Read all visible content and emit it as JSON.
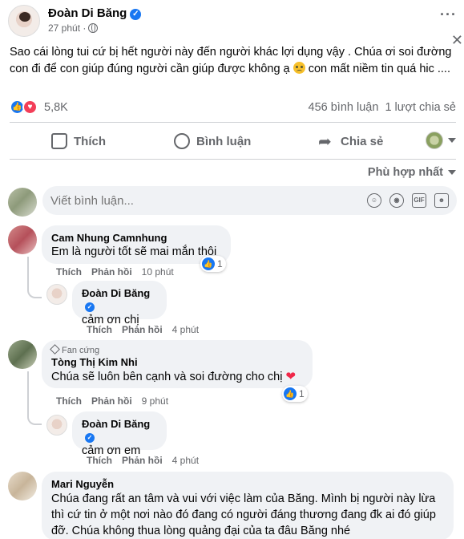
{
  "post": {
    "author": "Đoàn Di Băng",
    "time": "27 phút",
    "text": "Sao cái lòng tui cứ bị hết người này đến người khác lợi dụng vậy . Chúa ơi soi đường con đi để con giúp đúng người cần giúp được không ạ",
    "text_tail": "con mất niềm tin quá hic ....",
    "reaction_count": "5,8K",
    "comment_count": "456 bình luận",
    "share_count": "1 lượt chia sẻ"
  },
  "actions": {
    "like": "Thích",
    "comment": "Bình luận",
    "share": "Chia sẻ"
  },
  "sort_label": "Phù hợp nhất",
  "composer": {
    "placeholder": "Viết bình luận...",
    "gif_label": "GIF"
  },
  "comment_actions": {
    "like": "Thích",
    "reply": "Phản hồi"
  },
  "comments": [
    {
      "author": "Cam Nhung Camnhung",
      "body": "Em là người tốt sẽ mai mắn thôi",
      "time": "10 phút",
      "reactions": "1",
      "reply": {
        "author": "Đoàn Di Băng",
        "body": "cảm ơn chị",
        "time": "4 phút"
      }
    },
    {
      "badge": "Fan cứng",
      "author": "Tòng Thị Kim Nhi",
      "body": "Chúa sẽ luôn bên cạnh và soi đường cho chị",
      "time": "9 phút",
      "reactions": "1",
      "reply": {
        "author": "Đoàn Di Băng",
        "body": "cảm ơn em",
        "time": "4 phút"
      }
    },
    {
      "author": "Mari Nguyễn",
      "body": "Chúa đang rất an tâm và vui với việc làm của Băng. Mình bị người này lừa thì cứ tin ở một nơi nào đó đang có người đáng thương đang đk ai đó giúp đỡ. Chúa không thua lòng quảng đại của ta đâu Băng nhé"
    }
  ],
  "colors": {
    "accent": "#1877f2",
    "love": "#f33e58",
    "muted": "#65676b",
    "bubble": "#f0f2f5"
  }
}
